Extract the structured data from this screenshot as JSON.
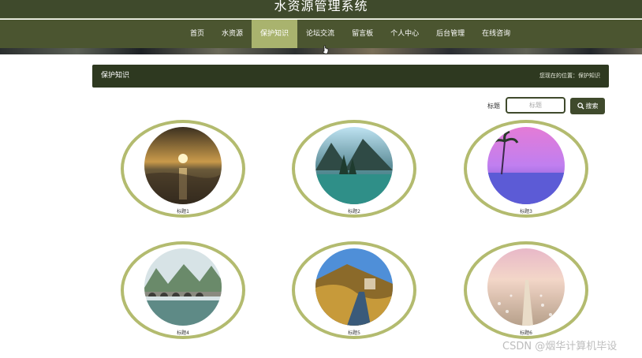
{
  "header": {
    "site_title": "水资源管理系统"
  },
  "nav": {
    "items": [
      {
        "label": "首页",
        "active": false
      },
      {
        "label": "水资源",
        "active": false
      },
      {
        "label": "保护知识",
        "active": true
      },
      {
        "label": "论坛交流",
        "active": false
      },
      {
        "label": "留言板",
        "active": false
      },
      {
        "label": "个人中心",
        "active": false
      },
      {
        "label": "后台管理",
        "active": false
      },
      {
        "label": "在线咨询",
        "active": false
      }
    ]
  },
  "section": {
    "title": "保护知识",
    "breadcrumb": "您现在的位置：保护知识"
  },
  "search": {
    "label": "标题",
    "placeholder": "标题",
    "button_label": "搜索"
  },
  "cards": [
    {
      "caption": "标题1",
      "image": "sunset-sea"
    },
    {
      "caption": "标题2",
      "image": "mountain-lake"
    },
    {
      "caption": "标题3",
      "image": "palm-pool"
    },
    {
      "caption": "标题4",
      "image": "bridge-river"
    },
    {
      "caption": "标题5",
      "image": "canal-road"
    },
    {
      "caption": "标题6",
      "image": "flower-path"
    }
  ],
  "watermark": "CSDN @烟华计算机毕设",
  "colors": {
    "nav_bg": "#4b5530",
    "nav_active": "#a9b36e",
    "accent_dark": "#2e3920",
    "ring": "#b3bb6f"
  }
}
